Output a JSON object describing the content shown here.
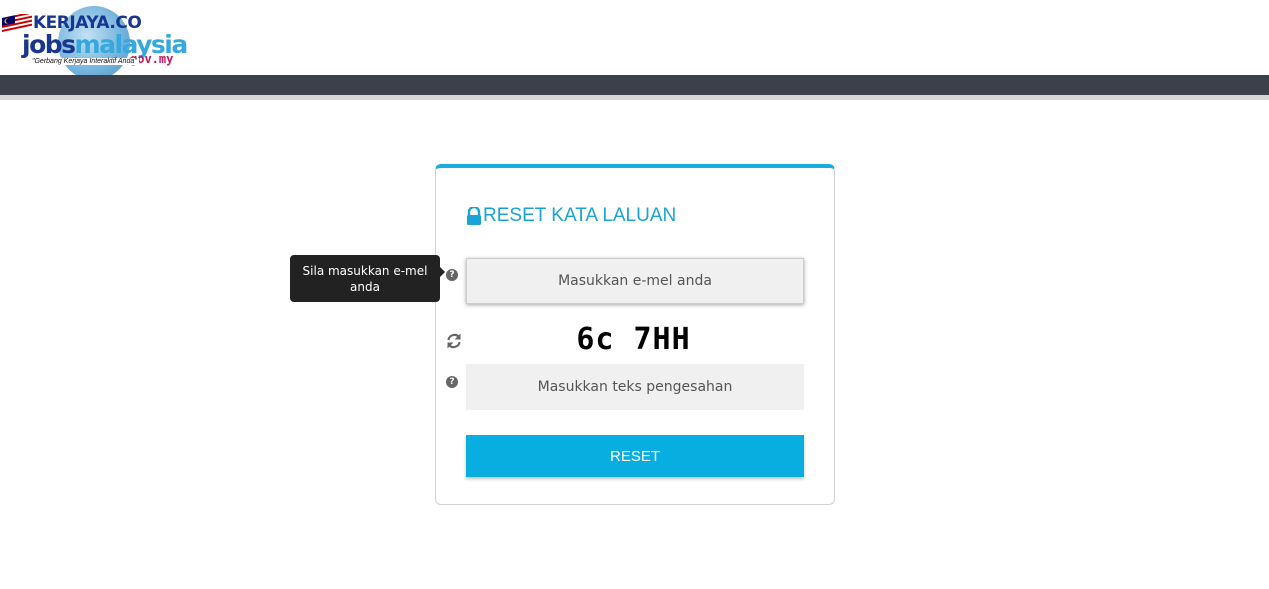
{
  "header": {
    "logo": {
      "brand_top": "KERJAYA.CO",
      "brand_jobs": "jobs",
      "brand_malaysia": "malaysia",
      "brand_domain": "gov.my",
      "tagline": "\"Gerbang Kerjaya Interaktif Anda\""
    }
  },
  "form": {
    "title": "RESET KATA LALUAN",
    "email": {
      "placeholder": "Masukkan e-mel anda",
      "value": ""
    },
    "captcha": {
      "code": "6c 7HH",
      "placeholder": "Masukkan teks pengesahan",
      "value": ""
    },
    "submit_label": "RESET",
    "help_icon_glyph": "?",
    "tooltip": "Sila masukkan e-mel anda"
  },
  "colors": {
    "accent": "#1aabdf",
    "button": "#08aee0",
    "navbar": "#3b404a",
    "tooltip_bg": "#222222"
  },
  "icons": [
    "lock-icon",
    "help-icon",
    "refresh-icon"
  ]
}
